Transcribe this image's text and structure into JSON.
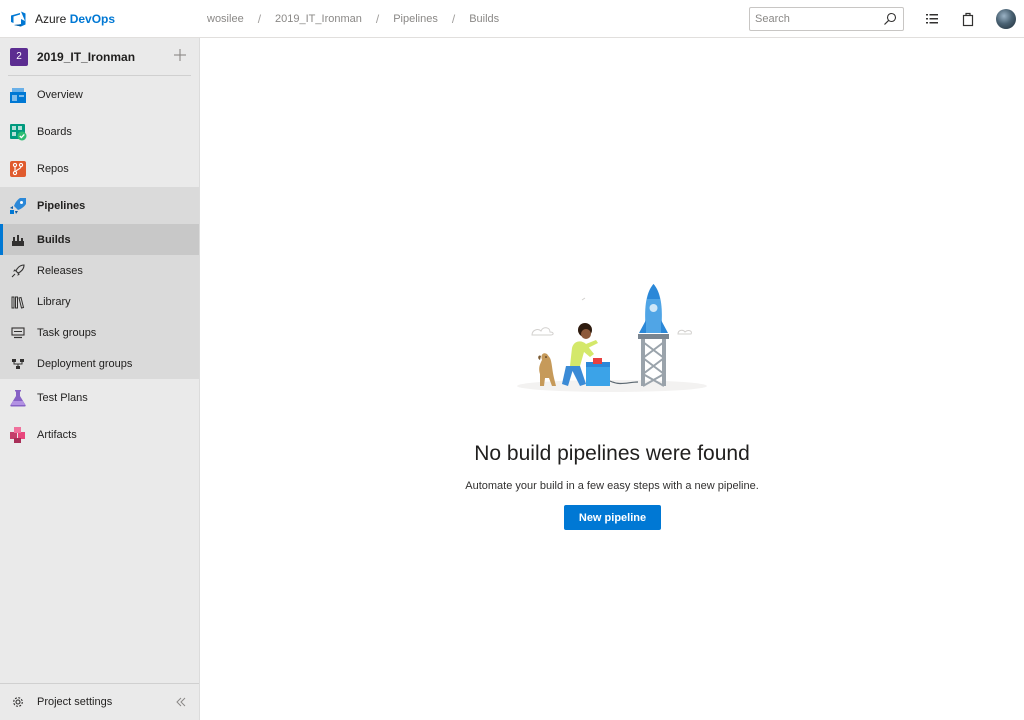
{
  "brand": {
    "prefix": "Azure",
    "name": "DevOps"
  },
  "breadcrumb": [
    "wosilee",
    "2019_IT_Ironman",
    "Pipelines",
    "Builds"
  ],
  "header": {
    "search_placeholder": "Search"
  },
  "sidebar": {
    "project": {
      "badge": "2",
      "name": "2019_IT_Ironman"
    },
    "items": [
      {
        "label": "Overview",
        "icon": "overview-icon"
      },
      {
        "label": "Boards",
        "icon": "boards-icon"
      },
      {
        "label": "Repos",
        "icon": "repos-icon"
      },
      {
        "label": "Pipelines",
        "icon": "pipelines-icon"
      },
      {
        "label": "Test Plans",
        "icon": "test-plans-icon"
      },
      {
        "label": "Artifacts",
        "icon": "artifacts-icon"
      }
    ],
    "pipelines_sub": [
      {
        "label": "Builds",
        "icon": "builds-icon",
        "active": true
      },
      {
        "label": "Releases",
        "icon": "releases-icon"
      },
      {
        "label": "Library",
        "icon": "library-icon"
      },
      {
        "label": "Task groups",
        "icon": "task-groups-icon"
      },
      {
        "label": "Deployment groups",
        "icon": "deployment-groups-icon"
      }
    ],
    "footer": {
      "label": "Project settings"
    }
  },
  "empty_state": {
    "title": "No build pipelines were found",
    "description": "Automate your build in a few easy steps with a new pipeline.",
    "button": "New pipeline"
  },
  "colors": {
    "accent": "#0078d4",
    "project_badge": "#5c2d91"
  }
}
